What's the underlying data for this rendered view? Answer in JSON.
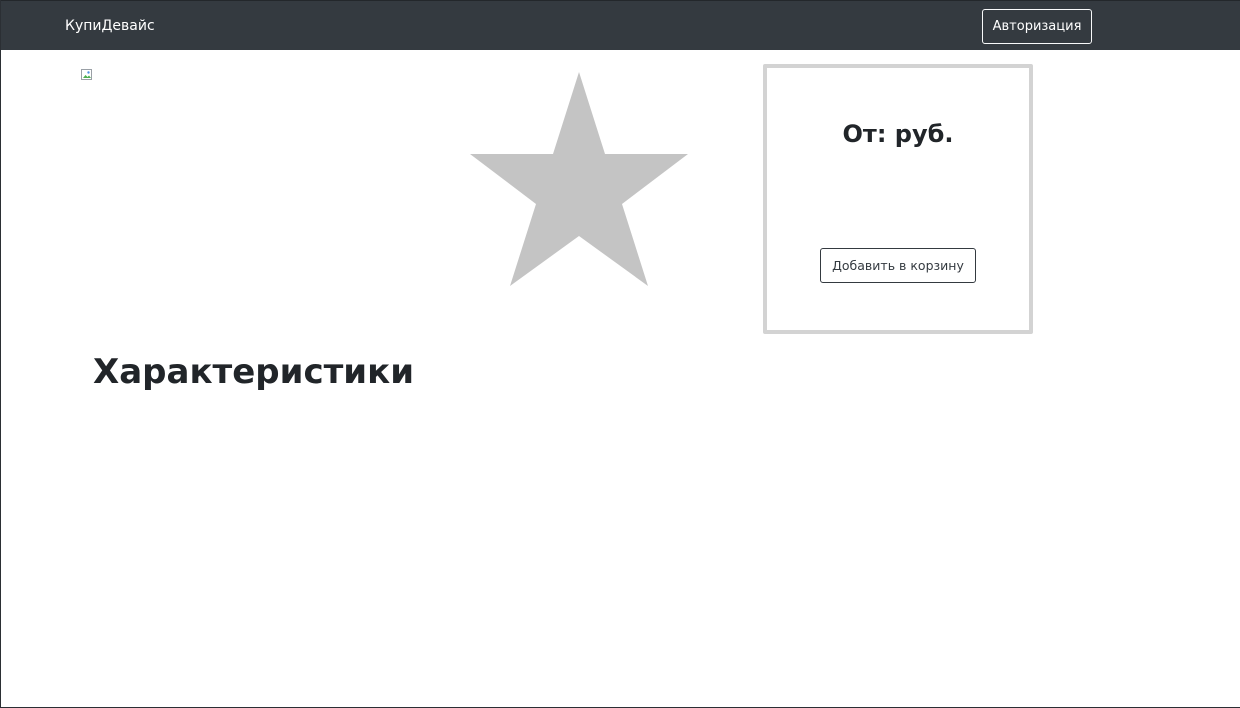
{
  "navbar": {
    "brand": "КупиДевайс",
    "auth_label": "Авторизация",
    "background_color": "#343a40"
  },
  "product": {
    "image_icon": "broken-image-icon",
    "rating_icon": "star-icon",
    "rating_color": "#c4c4c4"
  },
  "price_card": {
    "price_text": "От: руб.",
    "add_to_cart_label": "Добавить в корзину",
    "border_color": "#d3d3d3"
  },
  "characteristics": {
    "title": "Характеристики"
  }
}
